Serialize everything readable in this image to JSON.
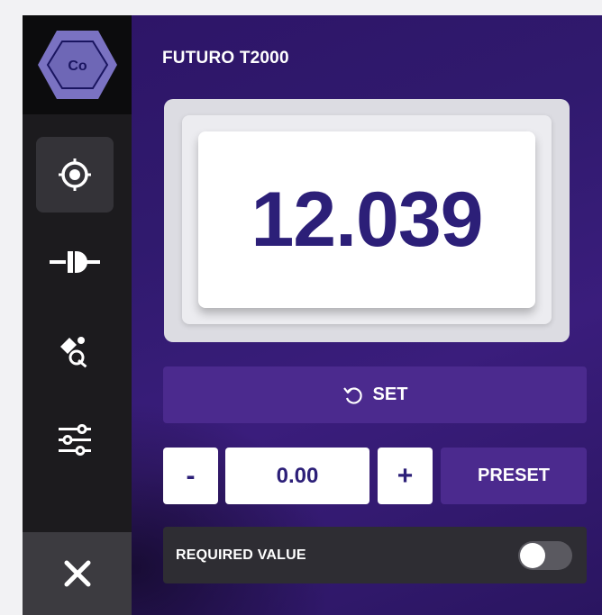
{
  "app": {
    "logo_text": "Co",
    "title": "FUTURO T2000"
  },
  "sidebar": {
    "items": [
      {
        "name": "target",
        "icon": "crosshair-icon",
        "active": true
      },
      {
        "name": "probe",
        "icon": "probe-icon",
        "active": false
      },
      {
        "name": "calibration",
        "icon": "key-tool-icon",
        "active": false
      },
      {
        "name": "settings",
        "icon": "sliders-icon",
        "active": false
      }
    ],
    "close_icon": "close-icon"
  },
  "display": {
    "reading": "12.039"
  },
  "controls": {
    "set_label": "SET",
    "minus_label": "-",
    "value": "0.00",
    "plus_label": "+",
    "preset_label": "PRESET"
  },
  "required": {
    "label": "REQUIRED VALUE",
    "toggle_on": false
  },
  "colors": {
    "accent": "#4b2a8e",
    "reading": "#2c1f78",
    "logo": "#7a72c2"
  }
}
